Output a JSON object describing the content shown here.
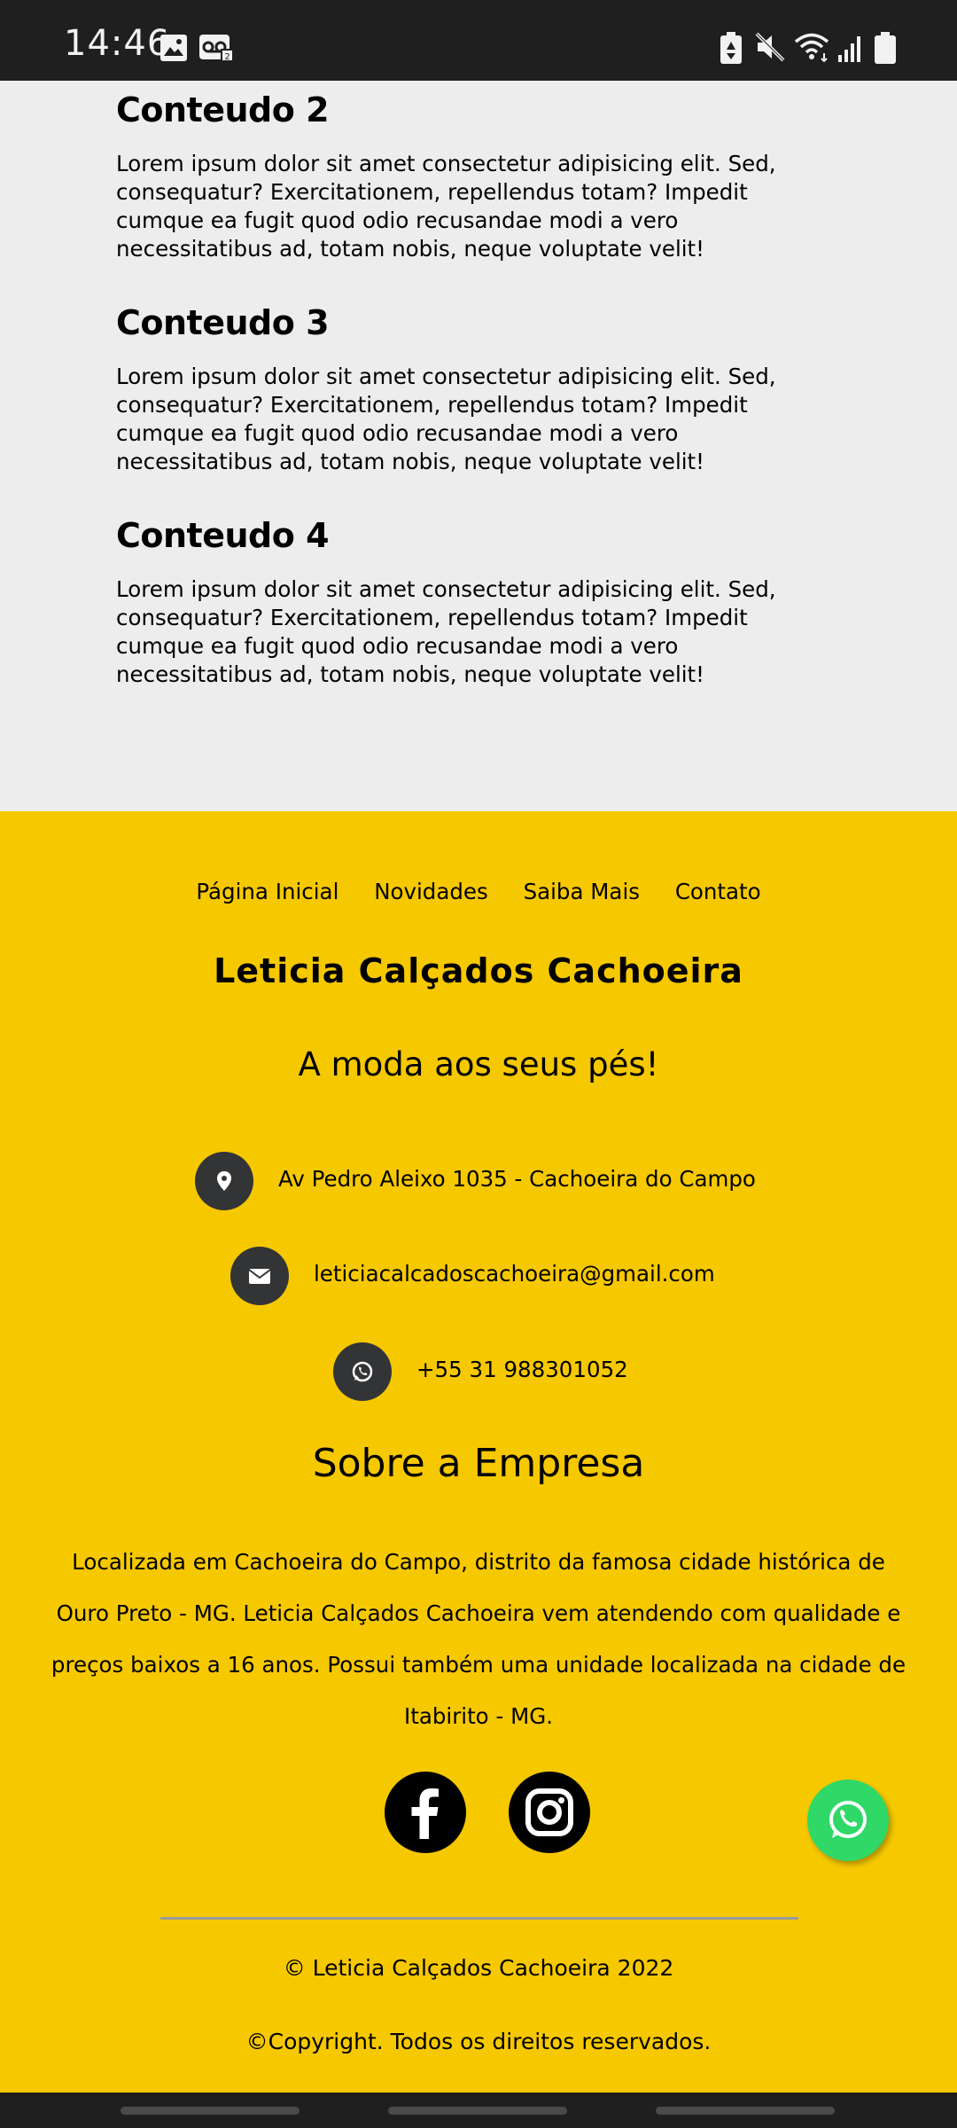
{
  "status_bar": {
    "time": "14:46",
    "left_icons": [
      "image-icon",
      "voicemail-icon"
    ],
    "right_icons": [
      "battery-saver-icon",
      "mute-icon",
      "wifi-icon",
      "signal-icon",
      "battery-icon"
    ]
  },
  "content": [
    {
      "title": "Conteudo 2",
      "text": "Lorem ipsum dolor sit amet consectetur adipisicing elit. Sed, consequatur? Exercitationem, repellendus totam? Impedit cumque ea fugit quod odio recusandae modi a vero necessitatibus ad, totam nobis, neque voluptate velit!"
    },
    {
      "title": "Conteudo 3",
      "text": "Lorem ipsum dolor sit amet consectetur adipisicing elit. Sed, consequatur? Exercitationem, repellendus totam? Impedit cumque ea fugit quod odio recusandae modi a vero necessitatibus ad, totam nobis, neque voluptate velit!"
    },
    {
      "title": "Conteudo 4",
      "text": "Lorem ipsum dolor sit amet consectetur adipisicing elit. Sed, consequatur? Exercitationem, repellendus totam? Impedit cumque ea fugit quod odio recusandae modi a vero necessitatibus ad, totam nobis, neque voluptate velit!"
    }
  ],
  "footer": {
    "nav": [
      "Página Inicial",
      "Novidades",
      "Saiba Mais",
      "Contato"
    ],
    "brand": "Leticia Calçados Cachoeira",
    "slogan": "A moda aos seus pés!",
    "contacts": {
      "address": "Av Pedro Aleixo 1035 - Cachoeira do Campo",
      "email": "leticiacalcadoscachoeira@gmail.com",
      "phone": "+55 31 988301052"
    },
    "about_title": "Sobre a Empresa",
    "about_text": "Localizada em Cachoeira do Campo, distrito da famosa cidade histórica de Ouro Preto - MG. Leticia Calçados Cachoeira vem atendendo com qualidade e preços baixos a 16 anos. Possui também uma unidade localizada na cidade de Itabirito - MG.",
    "social_icons": [
      "facebook-icon",
      "instagram-icon"
    ],
    "copyright_line1": "© Leticia Calçados Cachoeira 2022",
    "copyright_line2": "©Copyright. Todos os direitos reservados."
  },
  "colors": {
    "page_bg": "#ededed",
    "footer_bg": "#f6c800",
    "contact_circle": "#333436",
    "whatsapp_green": "#2fd867",
    "status_bar_bg": "#1f1f1f"
  }
}
